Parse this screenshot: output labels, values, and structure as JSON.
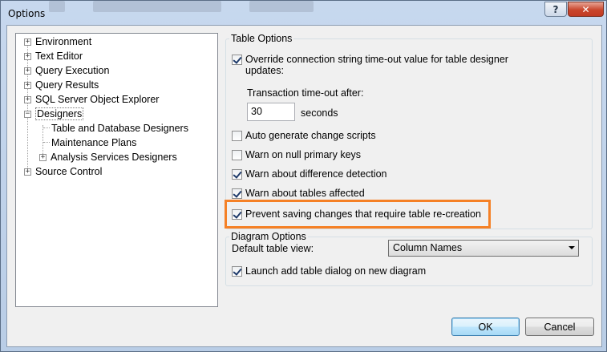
{
  "window": {
    "title": "Options"
  },
  "titlebar": {
    "help_label": "?",
    "close_label": "✕"
  },
  "tree": {
    "items": [
      {
        "label": "Environment",
        "expander": "+"
      },
      {
        "label": "Text Editor",
        "expander": "+"
      },
      {
        "label": "Query Execution",
        "expander": "+"
      },
      {
        "label": "Query Results",
        "expander": "+"
      },
      {
        "label": "SQL Server Object Explorer",
        "expander": "+"
      },
      {
        "label": "Designers",
        "expander": "−"
      },
      {
        "label": "Table and Database Designers"
      },
      {
        "label": "Maintenance Plans"
      },
      {
        "label": "Analysis Services Designers",
        "expander": "+"
      },
      {
        "label": "Source Control",
        "expander": "+"
      }
    ]
  },
  "table_options": {
    "title": "Table Options",
    "override_timeout": {
      "label_line1": "Override connection string time-out value for table designer",
      "label_line2": "updates:",
      "checked": true
    },
    "transaction_timeout_label": "Transaction time-out after:",
    "transaction_timeout_value": "30",
    "seconds_label": "seconds",
    "auto_generate": {
      "label": "Auto generate change scripts",
      "checked": false
    },
    "warn_null_pk": {
      "label": "Warn on null primary keys",
      "checked": false
    },
    "warn_difference": {
      "label": "Warn about difference detection",
      "checked": true
    },
    "warn_tables": {
      "label": "Warn about tables affected",
      "checked": true
    },
    "prevent_saving": {
      "label": "Prevent saving changes that require table re-creation",
      "checked": true
    }
  },
  "diagram_options": {
    "title": "Diagram Options",
    "default_view_label": "Default table view:",
    "default_view_value": "Column Names",
    "launch_add_table": {
      "label": "Launch add table dialog on new diagram",
      "checked": true
    }
  },
  "buttons": {
    "ok": "OK",
    "cancel": "Cancel"
  },
  "colors": {
    "highlight": "#f58025",
    "default_button": "#3c7fb1"
  }
}
